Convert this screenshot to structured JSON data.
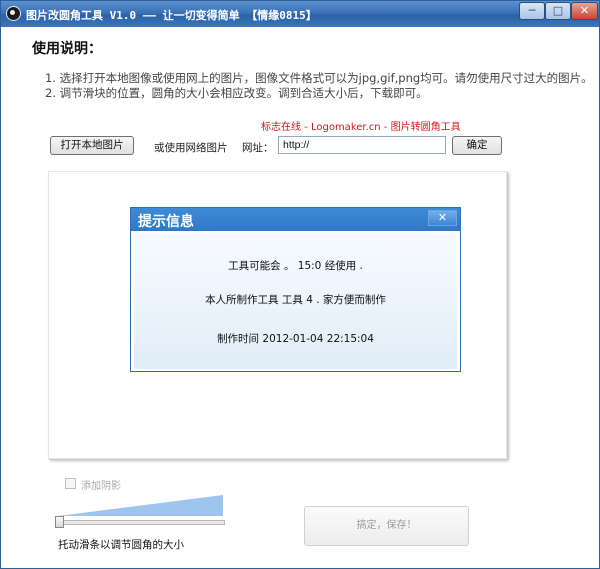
{
  "window": {
    "title": "图片改圆角工具 V1.0  —— 让一切变得简单 【情缘0815】",
    "minimize": "─",
    "maximize": "□",
    "close": "✕"
  },
  "usage": {
    "heading": "使用说明：",
    "line1": "1.  选择打开本地图像或使用网上的图片，图像文件格式可以为jpg,gif,png均可。请勿使用尺寸过大的图片。",
    "line2": "2.  调节滑块的位置，圆角的大小会相应改变。调到合适大小后，下载即可。"
  },
  "promo": "标志在线 - Logomaker.cn - 图片转圆角工具",
  "toolbar": {
    "open_local": "打开本地图片",
    "or_web": "或使用网络图片",
    "url_label": "网址：",
    "url_value": "http://",
    "confirm": "确定"
  },
  "dialog": {
    "title": "提示信息",
    "close": "✕",
    "line1": "工具可能会 。  15:0 经使用 .",
    "line2": "本人所制作工具 工具 4  .  家方便而制作",
    "line3": "制作时间 2012-01-04 22:15:04"
  },
  "options": {
    "shadow_label": "添加阴影",
    "shadow_checked": false,
    "slider_caption": "托动滑条以调节圆角的大小",
    "slider_value": 0
  },
  "save_button": "搞定，保存！",
  "colors": {
    "titlebar": "#3a72b8",
    "dialog_header": "#2f78c6",
    "promo_red": "#d4141b",
    "slider_wedge": "#9fc5ee"
  }
}
